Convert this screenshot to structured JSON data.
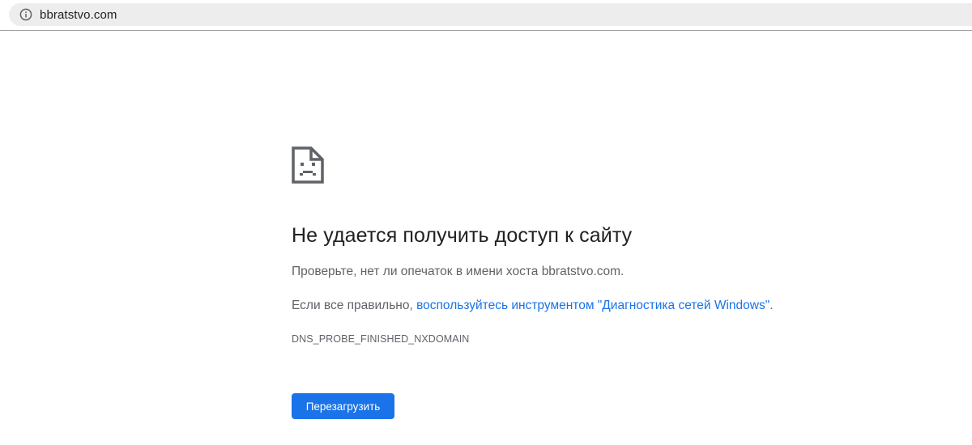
{
  "browser": {
    "url": "bbratstvo.com",
    "info_icon": "info-circle-icon"
  },
  "error_page": {
    "icon": "sad-page-icon",
    "title": "Не удается получить доступ к сайту",
    "hint": "Проверьте, нет ли опечаток в имени хоста bbratstvo.com.",
    "suggestion_prefix": "Если все правильно, ",
    "suggestion_link": "воспользуйтесь инструментом \"Диагностика сетей Windows\"",
    "suggestion_suffix": ".",
    "error_code": "DNS_PROBE_FINISHED_NXDOMAIN",
    "reload_label": "Перезагрузить"
  },
  "colors": {
    "accent": "#1a73e8",
    "text_primary": "#202124",
    "text_secondary": "#5f6368",
    "omnibox_bg": "#ededed"
  }
}
